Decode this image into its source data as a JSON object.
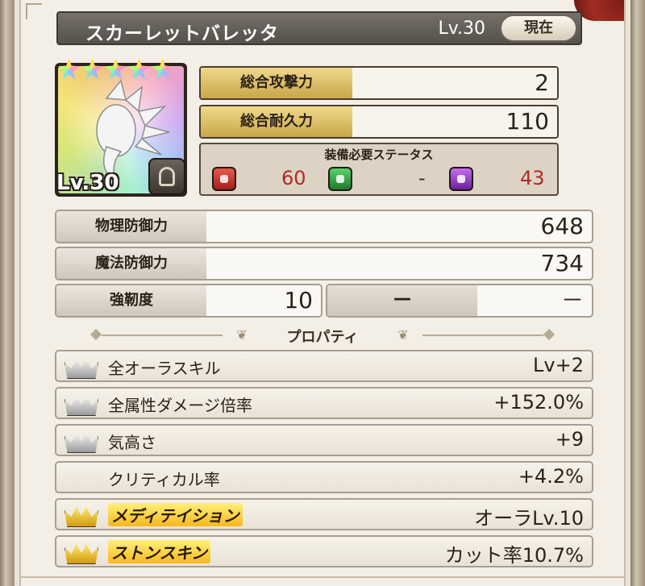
{
  "header": {
    "item_name": "スカーレットバレッタ",
    "level": "Lv.30",
    "current_button": "現在"
  },
  "item_icon": {
    "stars": 5,
    "level": "Lv.30",
    "type_icon": "helmet-icon"
  },
  "main_stats": [
    {
      "label": "総合攻撃力",
      "value": "2"
    },
    {
      "label": "総合耐久力",
      "value": "110"
    }
  ],
  "requirements": {
    "title": "装備必要ステータス",
    "items": [
      {
        "icon": "fist-icon",
        "color": "#b32828",
        "value": "60"
      },
      {
        "icon": "sparkle-icon",
        "color": "#2a8a3a",
        "value": "-"
      },
      {
        "icon": "staff-icon",
        "color": "#8a2ab0",
        "value": "43"
      }
    ]
  },
  "defense": [
    {
      "label": "物理防御力",
      "value": "648"
    },
    {
      "label": "魔法防御力",
      "value": "734"
    }
  ],
  "toughness": {
    "label": "強靭度",
    "value": "10"
  },
  "empty_stat": {
    "label": "－",
    "value": "－"
  },
  "properties": {
    "title": "プロパティ",
    "items": [
      {
        "label": "全オーラスキル",
        "value": "Lv+2",
        "crown": "silver"
      },
      {
        "label": "全属性ダメージ倍率",
        "value": "+152.0%",
        "crown": "silver"
      },
      {
        "label": "気高さ",
        "value": "+9",
        "crown": "silver"
      },
      {
        "label": "クリティカル率",
        "value": "+4.2%",
        "crown": "none"
      },
      {
        "label": "メディテイション",
        "value": "オーラLv.10",
        "crown": "gold"
      },
      {
        "label": "ストンスキン",
        "value": "カット率10.7%",
        "crown": "gold"
      }
    ]
  },
  "colors": {
    "gold_label": "#d8b658",
    "requirement_value": "#b32828",
    "title_bar": "#5f5a54"
  }
}
